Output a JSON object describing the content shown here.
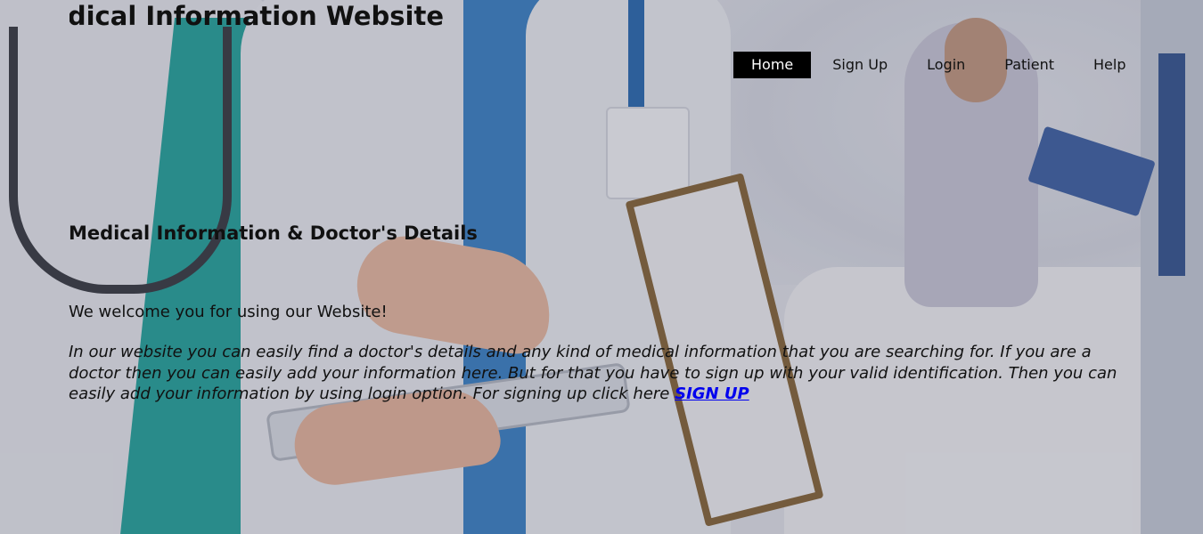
{
  "header": {
    "site_title": "Medical Information Website"
  },
  "nav": {
    "items": [
      {
        "label": "Home",
        "active": true
      },
      {
        "label": "Sign Up"
      },
      {
        "label": "Login"
      },
      {
        "label": "Patient"
      },
      {
        "label": "Help"
      }
    ]
  },
  "main": {
    "heading": "Medical Information & Doctor's Details",
    "welcome": "We welcome you for using our Website!",
    "description": "In our website you can easily find a doctor's details and any kind of medical information that you are searching for. If you are a doctor then you can easily add your information here. But for that you have to sign up with your valid identification. Then you can easily add your information by using login option. For signing up click here",
    "signup_link": "SIGN UP"
  },
  "colors": {
    "nav_active_bg": "#000000",
    "nav_active_text": "#ffffff",
    "link": "#0000ee",
    "text": "#111111"
  },
  "background": {
    "image": "medical-staff-photo"
  }
}
